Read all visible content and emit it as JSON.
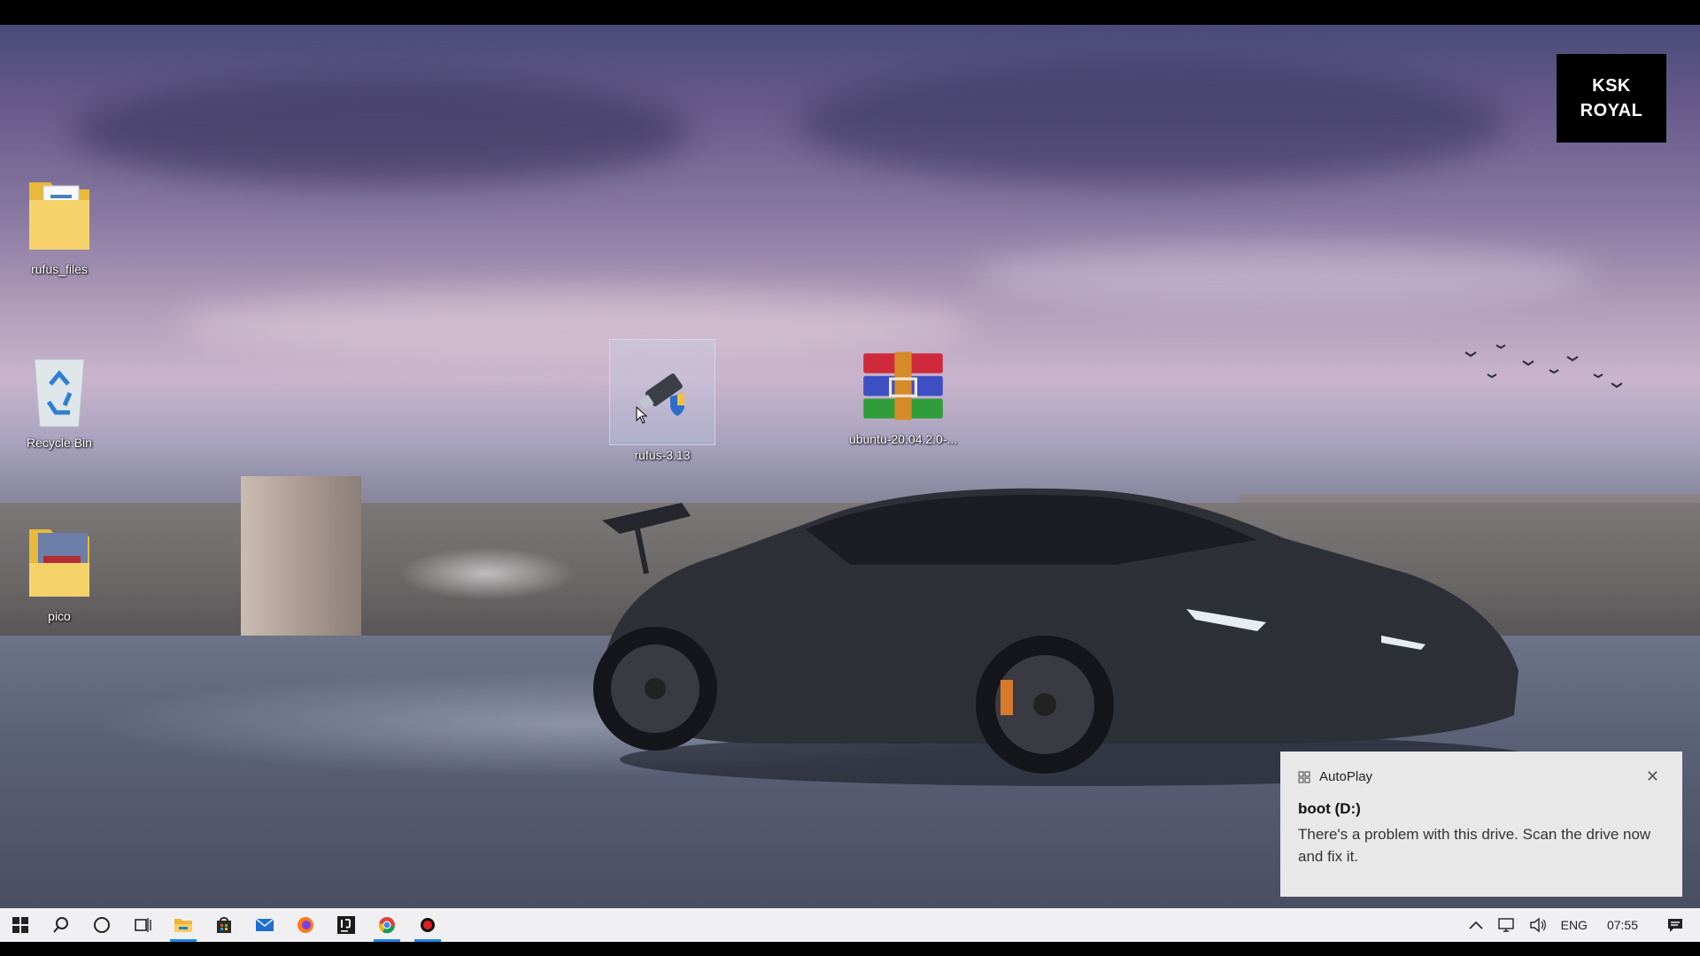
{
  "watermark": {
    "line1": "KSK",
    "line2": "ROYAL"
  },
  "desktop_icons": [
    {
      "label": "rufus_files",
      "icon": "folder-icon"
    },
    {
      "label": "Recycle Bin",
      "icon": "recycle-bin-icon"
    },
    {
      "label": "pico",
      "icon": "folder-icon"
    },
    {
      "label": "rufus-3.13",
      "icon": "usb-drive-icon"
    },
    {
      "label": "ubuntu-20.04.2.0-...",
      "icon": "winrar-archive-icon"
    }
  ],
  "notification": {
    "app_name": "AutoPlay",
    "title": "boot (D:)",
    "message": "There's a problem with this drive.  Scan the drive now and fix it.",
    "close_glyph": "✕"
  },
  "taskbar": {
    "pinned": [
      {
        "name": "start",
        "icon": "windows-start-icon",
        "active": false
      },
      {
        "name": "search",
        "icon": "search-icon",
        "active": false
      },
      {
        "name": "cortana",
        "icon": "cortana-icon",
        "active": false
      },
      {
        "name": "task-view",
        "icon": "task-view-icon",
        "active": false
      },
      {
        "name": "file-explorer",
        "icon": "file-explorer-icon",
        "active": true
      },
      {
        "name": "store",
        "icon": "store-icon",
        "active": false
      },
      {
        "name": "mail",
        "icon": "mail-icon",
        "active": false
      },
      {
        "name": "firefox",
        "icon": "firefox-icon",
        "active": false
      },
      {
        "name": "intellij",
        "icon": "intellij-icon",
        "active": false
      },
      {
        "name": "chrome",
        "icon": "chrome-icon",
        "active": true
      },
      {
        "name": "recorder",
        "icon": "record-icon",
        "active": true
      }
    ],
    "tray": {
      "language": "ENG",
      "time": "07:55"
    }
  },
  "colors": {
    "accent": "#1e88e5",
    "taskbar_bg": "#f0f0f2",
    "toast_bg": "#e8e8e8"
  }
}
